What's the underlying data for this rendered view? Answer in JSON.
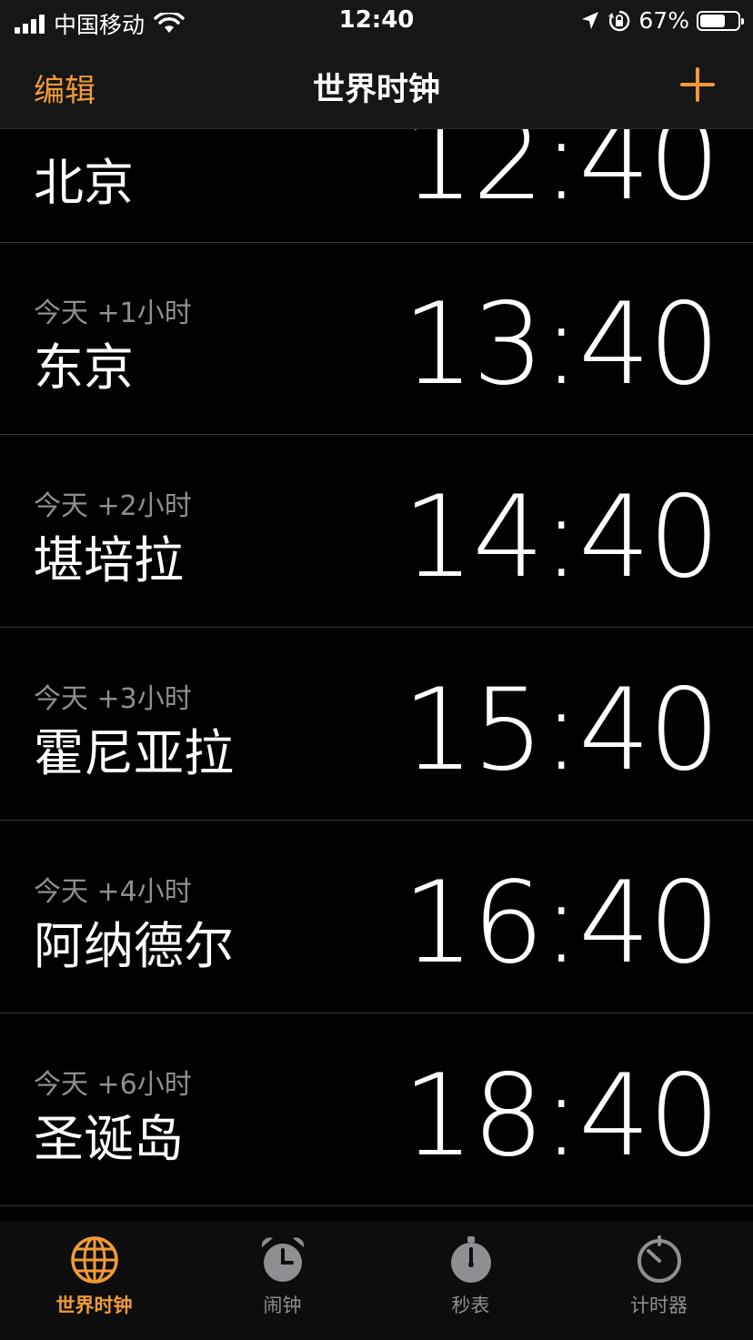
{
  "status_bar": {
    "carrier": "中国移动",
    "time": "12:40",
    "battery_percent": "67%",
    "battery_level": 0.67
  },
  "nav": {
    "edit_label": "编辑",
    "title": "世界时钟",
    "add_icon": "plus-icon"
  },
  "clocks": [
    {
      "offset": "",
      "city": "北京",
      "time": "12:40"
    },
    {
      "offset": "今天 +1小时",
      "city": "东京",
      "time": "13:40"
    },
    {
      "offset": "今天 +2小时",
      "city": "堪培拉",
      "time": "14:40"
    },
    {
      "offset": "今天 +3小时",
      "city": "霍尼亚拉",
      "time": "15:40"
    },
    {
      "offset": "今天 +4小时",
      "city": "阿纳德尔",
      "time": "16:40"
    },
    {
      "offset": "今天 +6小时",
      "city": "圣诞岛",
      "time": "18:40"
    }
  ],
  "tabs": [
    {
      "label": "世界时钟",
      "icon": "globe-icon",
      "active": true
    },
    {
      "label": "闹钟",
      "icon": "alarm-clock-icon",
      "active": false
    },
    {
      "label": "秒表",
      "icon": "stopwatch-icon",
      "active": false
    },
    {
      "label": "计时器",
      "icon": "timer-icon",
      "active": false
    }
  ],
  "colors": {
    "accent": "#f19a37",
    "background": "#000000",
    "secondary_text": "#8e8e93"
  }
}
